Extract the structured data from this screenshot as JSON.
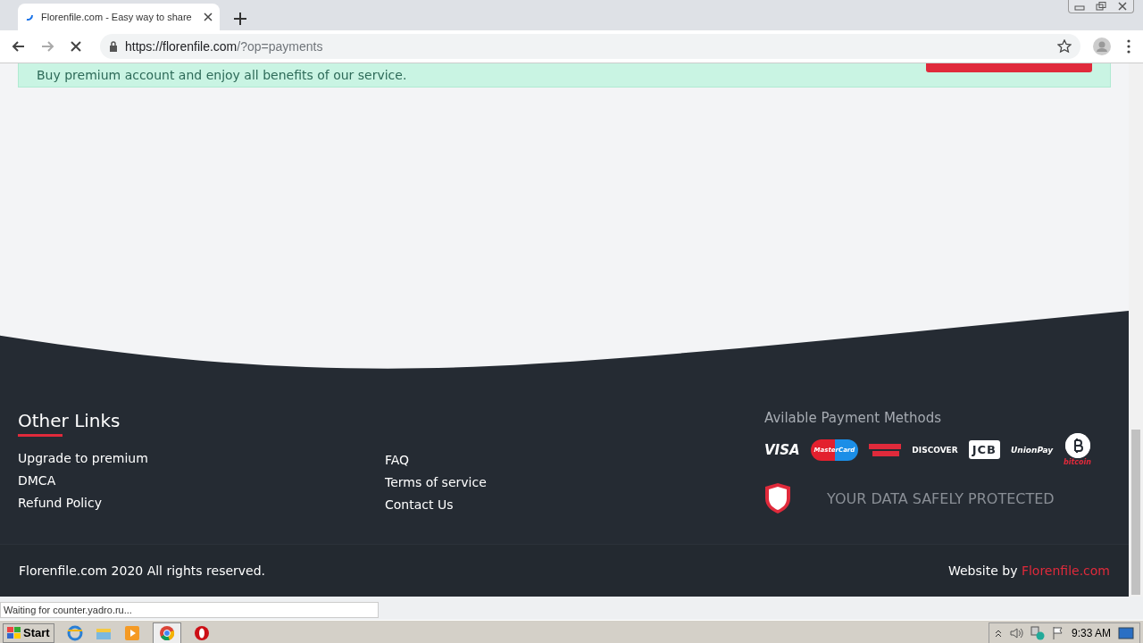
{
  "browser": {
    "tab": {
      "title": "Florenfile.com - Easy way to share",
      "selected": true
    },
    "url_host": "https://florenfile.com",
    "url_path": "/?op=payments",
    "loading": true
  },
  "banner": {
    "text": "Buy premium account and enjoy all benefits of our service."
  },
  "footer": {
    "heading": "Other Links",
    "links_left": [
      "Upgrade to premium",
      "DMCA",
      "Refund Policy"
    ],
    "links_right": [
      "FAQ",
      "Terms of service",
      "Contact Us"
    ],
    "payments_title": "Avilable Payment Methods",
    "payment_methods": [
      {
        "kind": "visa",
        "label": "VISA"
      },
      {
        "kind": "mastercard",
        "label": "MasterCard"
      },
      {
        "kind": "amex"
      },
      {
        "kind": "discover",
        "label": "DISCOVER"
      },
      {
        "kind": "jcb",
        "label": "JCB"
      },
      {
        "kind": "unionpay",
        "label": "UnionPay"
      },
      {
        "kind": "bitcoin",
        "label": "bitcoin"
      }
    ],
    "protected_text": "YOUR DATA SAFELY PROTECTED",
    "copyright": "Florenfile.com 2020 All rights reserved.",
    "credit_prefix": "Website by ",
    "credit_link": "Florenfile.com"
  },
  "status_text": "Waiting for counter.yadro.ru...",
  "taskbar": {
    "start": "Start",
    "clock": "9:33 AM"
  }
}
